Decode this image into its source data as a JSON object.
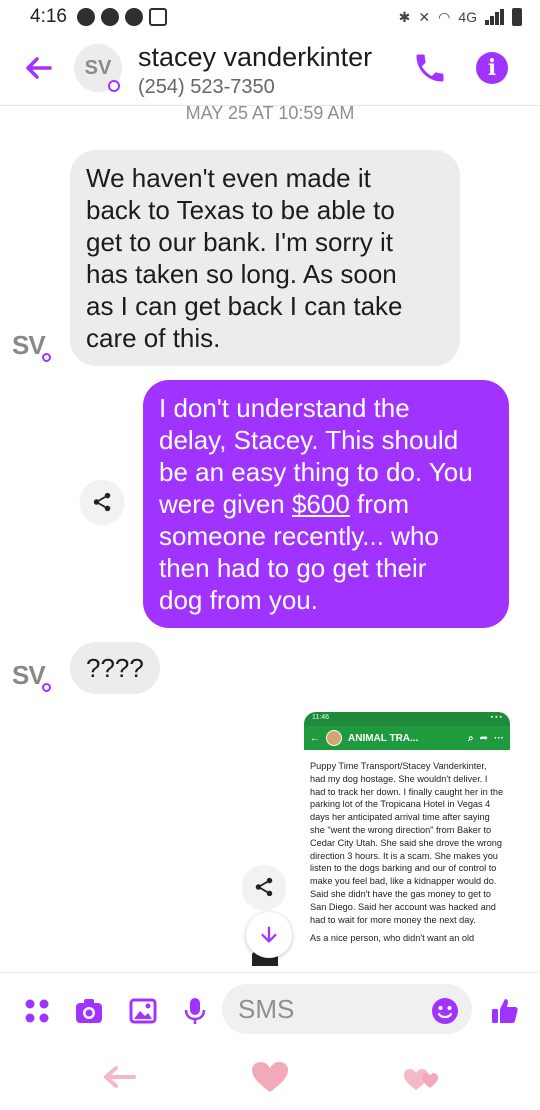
{
  "status_bar": {
    "time": "4:16",
    "network": "4G"
  },
  "header": {
    "avatar_initials": "SV",
    "contact_name": "stacey vanderkinter",
    "contact_phone": "(254) 523-7350",
    "accent_color": "#a033ff"
  },
  "timestamp": "MAY 25 AT 10:59 AM",
  "messages": [
    {
      "direction": "incoming",
      "lines": [
        "We haven't even made it",
        "back to Texas to be able to",
        "get to our bank. I'm sorry it",
        "has taken so long.  As soon",
        "as I can get back I can take",
        "care of this."
      ]
    },
    {
      "direction": "outgoing",
      "lines_before_link": [
        "I don't understand the",
        "delay, Stacey. This should",
        "be an easy thing to do. You"
      ],
      "link_prefix": "were given ",
      "link_text": "$600",
      "link_suffix": " from",
      "lines_after_link": [
        "someone recently... who",
        "then had to go get their",
        "dog from you."
      ]
    },
    {
      "direction": "incoming",
      "lines": [
        "????"
      ]
    }
  ],
  "sender_badge": "SV",
  "attachment": {
    "status_time": "11:46",
    "title": "ANIMAL TRA...",
    "paragraph_1": "Puppy Time Transport/Stacey Vanderkinter,  had my dog hostage. She wouldn't deliver. I had to track her down. I finally caught her in the parking lot of the Tropicana Hotel in Vegas 4 days her anticipated arrival time after saying she \"went the wrong direction\" from Baker to Cedar City Utah. She said she drove the wrong direction 3 hours. It is a scam. She makes you listen to the dogs barking and our of control to make you feel bad, like a kidnapper would do. Said she didn't have the gas money to get to San Diego. Said her account was hacked and had to wait for more money the next day.",
    "paragraph_2": "As a nice person, who didn't want an old"
  },
  "composer": {
    "placeholder": "SMS"
  },
  "icons": [
    "back-arrow-icon",
    "phone-icon",
    "info-icon",
    "share-icon",
    "scroll-down-icon",
    "apps-icon",
    "camera-icon",
    "gallery-icon",
    "microphone-icon",
    "emoji-icon",
    "thumbs-up-icon",
    "heart-icon"
  ]
}
